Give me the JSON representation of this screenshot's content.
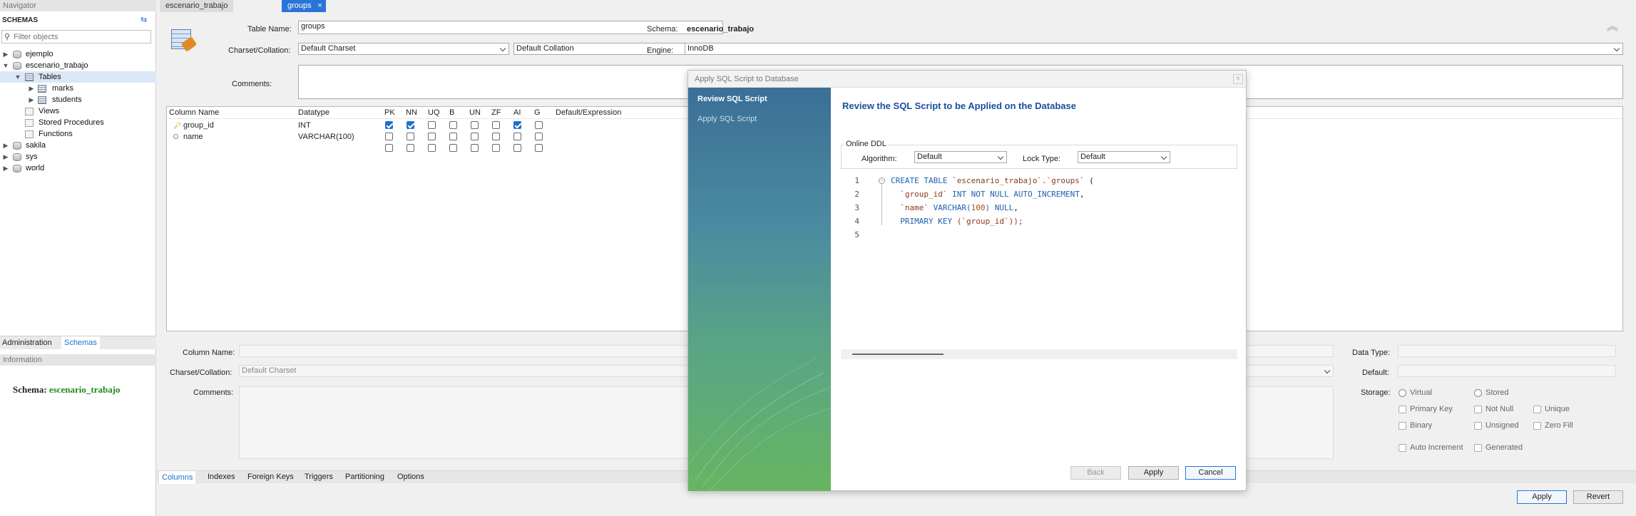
{
  "navigator": {
    "title": "Navigator",
    "schemas_header": "SCHEMAS",
    "filter_placeholder": "Filter objects",
    "tree": [
      {
        "label": "ejemplo"
      },
      {
        "label": "escenario_trabajo"
      },
      {
        "label": "Tables"
      },
      {
        "label": "marks"
      },
      {
        "label": "students"
      },
      {
        "label": "Views"
      },
      {
        "label": "Stored Procedures"
      },
      {
        "label": "Functions"
      },
      {
        "label": "sakila"
      },
      {
        "label": "sys"
      },
      {
        "label": "world"
      }
    ],
    "bottom_tabs": [
      "Administration",
      "Schemas"
    ],
    "info_header": "Information",
    "info_schema_label": "Schema:",
    "info_schema_value": "escenario_trabajo"
  },
  "tabs": [
    {
      "label": "escenario_trabajo - Schema"
    },
    {
      "label": "groups - Table"
    }
  ],
  "table_form": {
    "table_name_label": "Table Name:",
    "table_name_value": "groups",
    "schema_label": "Schema:",
    "schema_value": "escenario_trabajo",
    "charset_label": "Charset/Collation:",
    "charset_value": "Default Charset",
    "collation_value": "Default Collation",
    "engine_label": "Engine:",
    "engine_value": "InnoDB",
    "comments_label": "Comments:"
  },
  "columns_grid": {
    "headers": [
      "Column Name",
      "Datatype",
      "PK",
      "NN",
      "UQ",
      "B",
      "UN",
      "ZF",
      "AI",
      "G",
      "Default/Expression"
    ],
    "rows": [
      {
        "name": "group_id",
        "type": "INT",
        "flags": [
          true,
          true,
          false,
          false,
          false,
          false,
          true,
          false
        ]
      },
      {
        "name": "name",
        "type": "VARCHAR(100)",
        "flags": [
          false,
          false,
          false,
          false,
          false,
          false,
          false,
          false
        ]
      },
      {
        "name": "",
        "type": "",
        "flags": [
          false,
          false,
          false,
          false,
          false,
          false,
          false,
          false
        ]
      }
    ]
  },
  "column_details": {
    "column_name_label": "Column Name:",
    "charset_label": "Charset/Collation:",
    "charset_value": "Default Charset",
    "comments_label": "Comments:",
    "data_type_label": "Data Type:",
    "default_label": "Default:",
    "storage_label": "Storage:",
    "storage_options": [
      "Virtual",
      "Stored"
    ],
    "checkboxes": [
      "Primary Key",
      "Not Null",
      "Unique",
      "Binary",
      "Unsigned",
      "Zero Fill",
      "Auto Increment",
      "Generated"
    ]
  },
  "bottom_tabs": [
    "Columns",
    "Indexes",
    "Foreign Keys",
    "Triggers",
    "Partitioning",
    "Options"
  ],
  "footer_buttons": {
    "apply": "Apply",
    "revert": "Revert"
  },
  "dialog": {
    "title": "Apply SQL Script to Database",
    "steps": [
      "Review SQL Script",
      "Apply SQL Script"
    ],
    "heading": "Review the SQL Script to be Applied on the Database",
    "online_ddl_label": "Online DDL",
    "algorithm_label": "Algorithm:",
    "algorithm_value": "Default",
    "lock_type_label": "Lock Type:",
    "lock_type_value": "Default",
    "line_numbers": [
      "1",
      "2",
      "3",
      "4",
      "5"
    ],
    "sql": {
      "l1_kw": "CREATE TABLE",
      "l1_str": "`escenario_trabajo`.`groups`",
      "l1_end": " (",
      "l2_str": "`group_id`",
      "l2_kw": "INT NOT NULL AUTO_INCREMENT",
      "l2_end": ",",
      "l3_str": "`name`",
      "l3_kw": "VARCHAR(",
      "l3_num": "100",
      "l3_kw2": ") NULL",
      "l3_end": ",",
      "l4_kw": "PRIMARY KEY",
      "l4_str": "(`group_id`));"
    },
    "buttons": {
      "back": "Back",
      "apply": "Apply",
      "cancel": "Cancel"
    }
  },
  "colors": {
    "accent": "#1e6fd0",
    "heading": "#1a4f9c",
    "schema_green": "#1f8a1f"
  }
}
